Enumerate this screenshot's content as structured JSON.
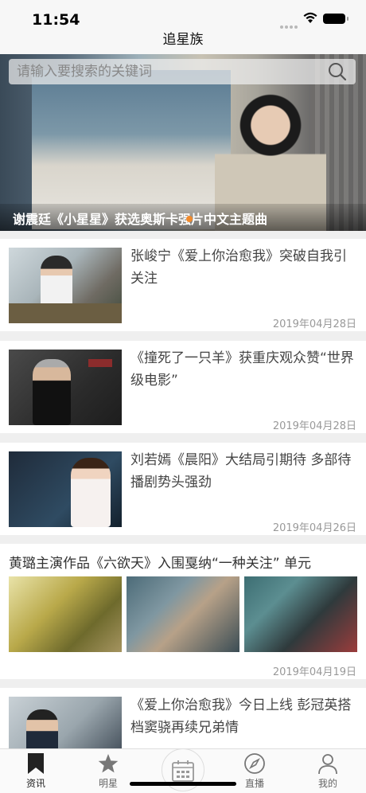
{
  "status": {
    "time": "11:54"
  },
  "nav": {
    "title": "追星族"
  },
  "search": {
    "placeholder": "请输入要搜索的关键词"
  },
  "banner": {
    "title": "谢震廷《小星星》获选奥斯卡强片中文主题曲"
  },
  "news": [
    {
      "title": "张峻宁《爱上你治愈我》突破自我引关注",
      "date": "2019年04月28日"
    },
    {
      "title": "《撞死了一只羊》获重庆观众赞“世界级电影”",
      "date": "2019年04月28日"
    },
    {
      "title": "刘若嫣《晨阳》大结局引期待 多部待播剧势头强劲",
      "date": "2019年04月26日"
    }
  ],
  "gallery": {
    "title": "黄璐主演作品《六欲天》入围戛纳“一种关注” 单元",
    "date": "2019年04月19日"
  },
  "last_news": {
    "title": "《爱上你治愈我》今日上线 彭冠英搭档窦骁再续兄弟情"
  },
  "tabs": [
    {
      "label": "资讯",
      "icon": "bookmark-icon"
    },
    {
      "label": "明星",
      "icon": "star-icon"
    },
    {
      "label": "",
      "icon": "calendar-icon"
    },
    {
      "label": "直播",
      "icon": "compass-icon"
    },
    {
      "label": "我的",
      "icon": "person-icon"
    }
  ]
}
